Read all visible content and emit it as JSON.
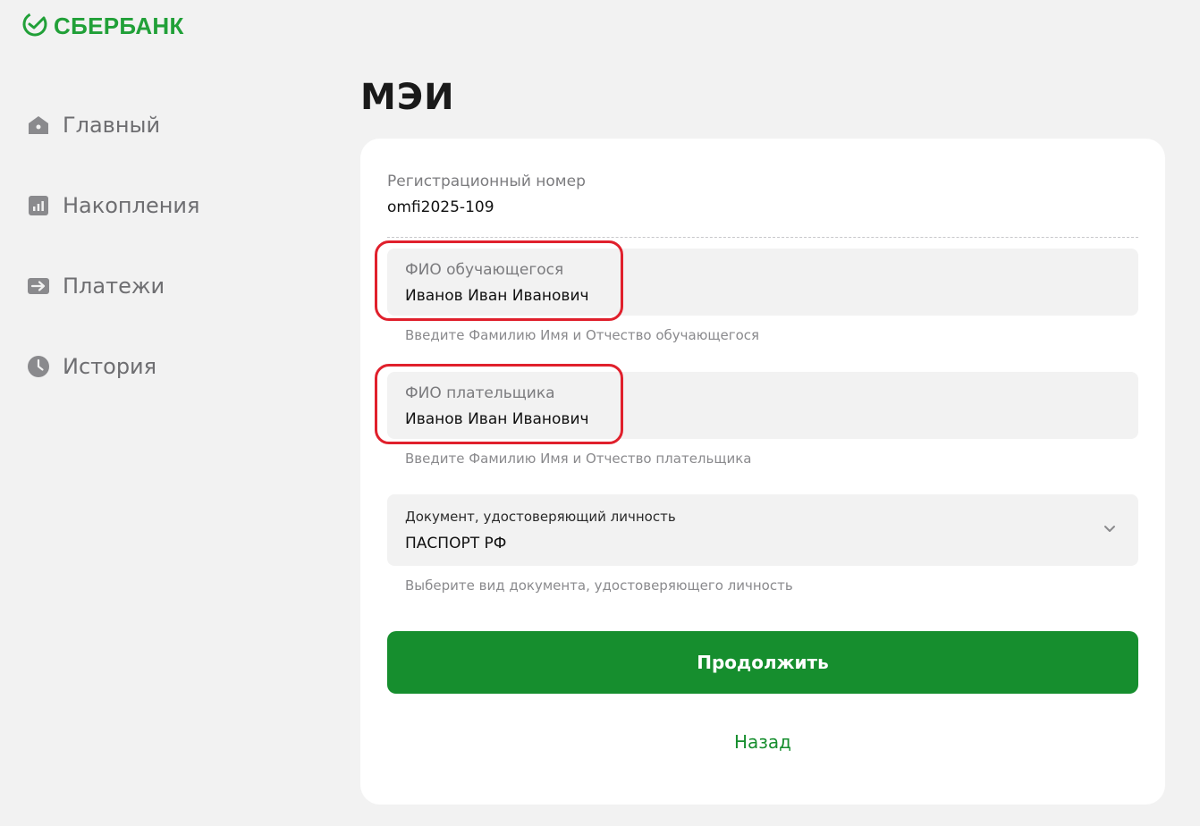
{
  "brand": {
    "name": "СБЕРБАНК",
    "color": "#21a038"
  },
  "nav": {
    "items": [
      {
        "label": "Главный",
        "icon": "home-icon"
      },
      {
        "label": "Накопления",
        "icon": "chart-icon"
      },
      {
        "label": "Платежи",
        "icon": "arrow-right-icon"
      },
      {
        "label": "История",
        "icon": "clock-icon"
      }
    ]
  },
  "page": {
    "title": "МЭИ"
  },
  "form": {
    "reg_label": "Регистрационный номер",
    "reg_value": "omfi2025-109",
    "student": {
      "label": "ФИО обучающегося",
      "value": "Иванов Иван Иванович",
      "hint": "Введите Фамилию Имя и Отчество обучающегося"
    },
    "payer": {
      "label": "ФИО плательщика",
      "value": "Иванов Иван Иванович",
      "hint": "Введите Фамилию Имя и Отчество плательщика"
    },
    "document": {
      "label": "Документ, удостоверяющий личность",
      "value": "ПАСПОРТ РФ",
      "hint": "Выберите вид документа, удостоверяющего личность"
    },
    "continue_label": "Продолжить",
    "back_label": "Назад"
  },
  "colors": {
    "accent": "#168e2e",
    "highlight": "#e0202c"
  }
}
